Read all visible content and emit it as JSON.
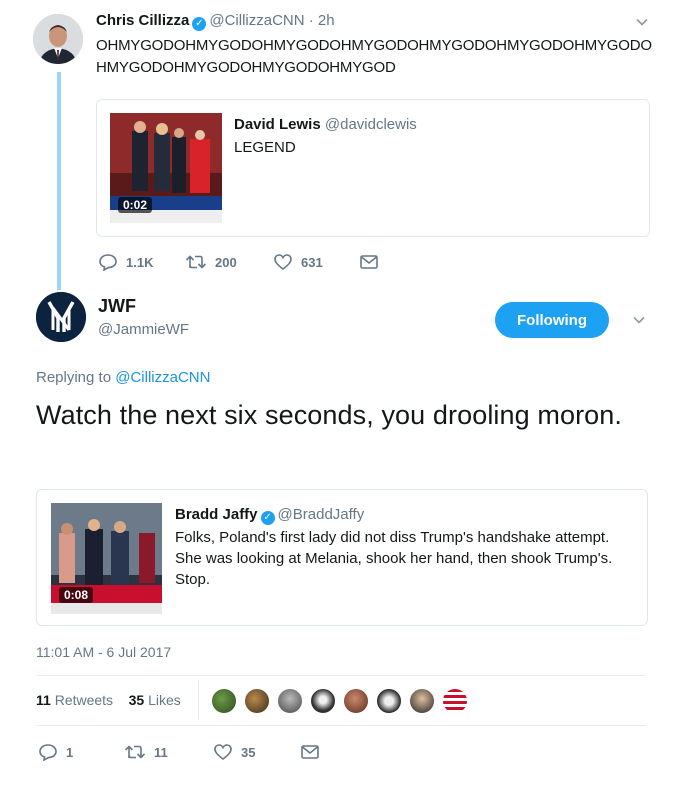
{
  "parent_tweet": {
    "name": "Chris Cillizza",
    "handle": "@CillizzaCNN",
    "time": "· 2h",
    "text": "OHMYGODOHMYGODOHMYGODOHMYGODOHMYGODOHMYGODOHMYGODOHMYGODOHMYGODOHMYGODOHMYGOD",
    "quote": {
      "name": "David Lewis",
      "handle": "@davidclewis",
      "text": "LEGEND",
      "video_duration": "0:02"
    },
    "actions": {
      "replies": "1.1K",
      "retweets": "200",
      "likes": "631"
    }
  },
  "main_tweet": {
    "name": "JWF",
    "handle": "@JammieWF",
    "follow_label": "Following",
    "replying_prefix": "Replying to",
    "replying_handle": "@CillizzaCNN",
    "text": "Watch the next six seconds, you drooling moron.",
    "quote": {
      "name": "Bradd Jaffy",
      "handle": "@BraddJaffy",
      "text": "Folks, Poland's first lady did not diss Trump's handshake attempt. She was looking at Melania, shook her hand, then shook Trump's. Stop.",
      "video_duration": "0:08"
    },
    "timestamp": "11:01 AM - 6 Jul 2017",
    "stats": {
      "retweets_count": "11",
      "retweets_label": "Retweets",
      "likes_count": "35",
      "likes_label": "Likes"
    },
    "actions": {
      "replies": "1",
      "retweets": "11",
      "likes": "35"
    }
  },
  "colors": {
    "accent": "#1da1f2",
    "thread_line": "#99d7f5",
    "muted": "#657786"
  }
}
